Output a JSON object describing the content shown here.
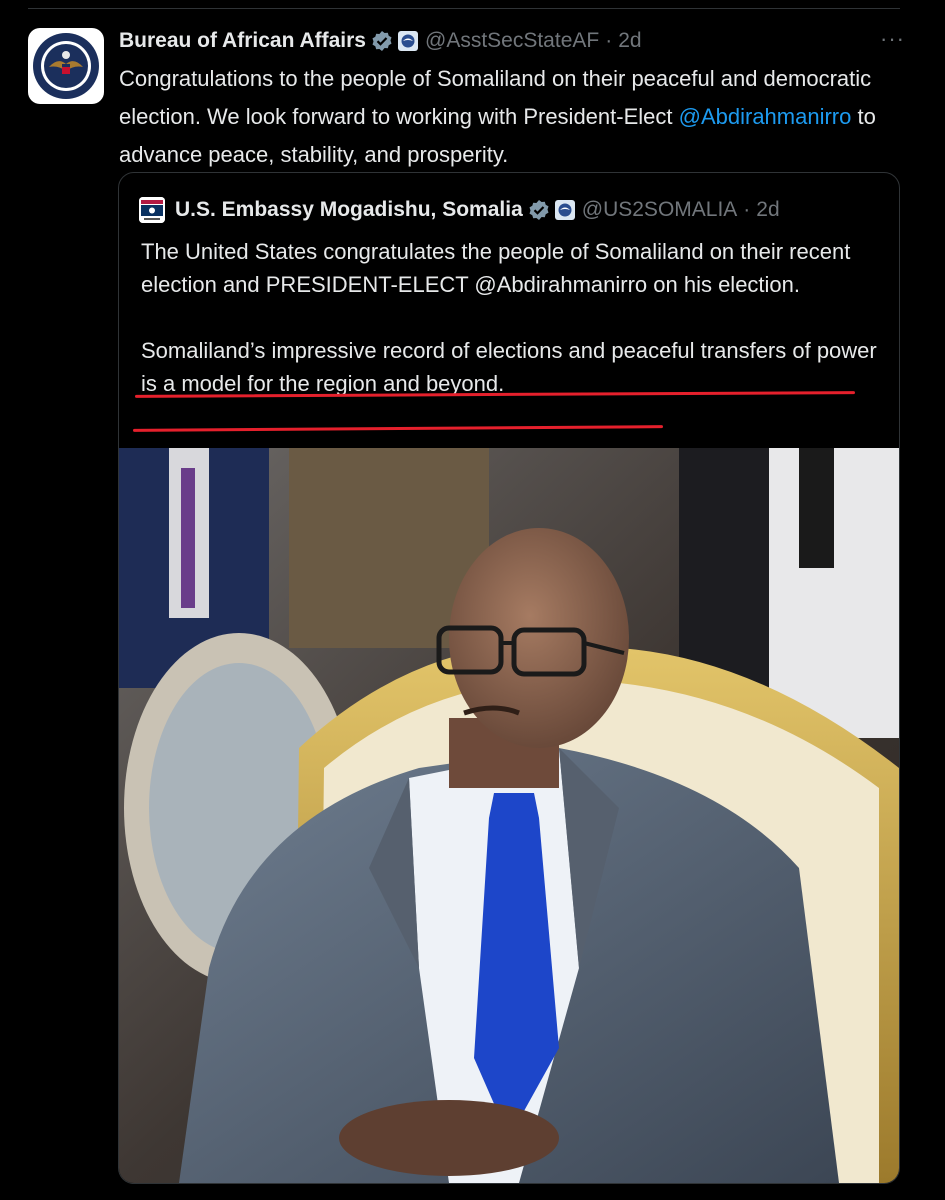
{
  "tweet": {
    "author_name": "Bureau of African Affairs",
    "handle": "@AsstSecStateAF",
    "separator": "·",
    "time": "2d",
    "more_label": "···",
    "text_before": "Congratulations to the people of Somaliland on their peaceful and democratic election. We look forward to working with President-Elect ",
    "mention": "@Abdirahmanirro",
    "text_after": " to advance peace, stability, and prosperity."
  },
  "quote": {
    "author_name": "U.S. Embassy Mogadishu, Somalia",
    "handle": "@US2SOMALIA",
    "separator": "·",
    "time": "2d",
    "paragraph1": "The United States congratulates the people of Somaliland on their recent election and PRESIDENT-ELECT @Abdirahmanirro on his election.",
    "paragraph2": "Somaliland’s impressive record of elections and peaceful transfers of power is a model for the region and beyond."
  },
  "icons": {
    "verified": "verified-checkmark-icon",
    "government": "government-badge-icon",
    "more": "more-options-icon"
  },
  "colors": {
    "background": "#000000",
    "text": "#e7e9ea",
    "secondary": "#71767b",
    "link": "#1d9bf0",
    "underline_annotation": "#e5202c"
  }
}
